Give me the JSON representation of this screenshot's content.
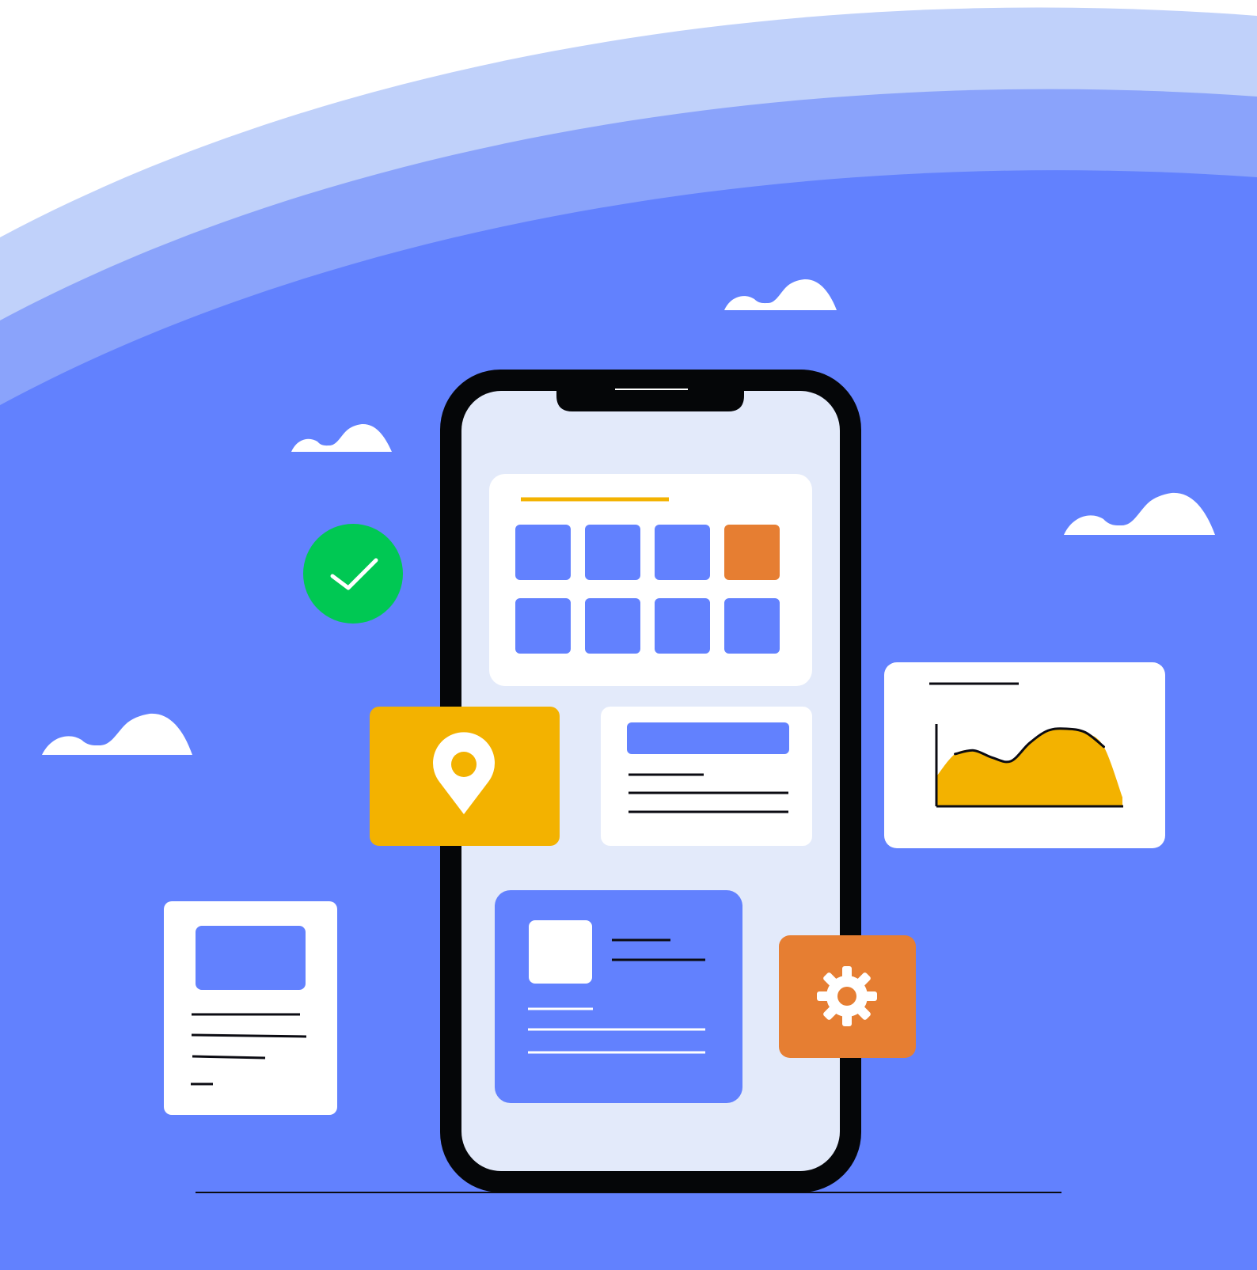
{
  "colors": {
    "sky_top": "#ffffff",
    "band_light": "#c0d1fa",
    "band_mid": "#8aa3fb",
    "background": "#6281fe",
    "phone_frame": "#050608",
    "phone_screen": "#e3eafa",
    "card_white": "#ffffff",
    "tile_blue": "#6281fe",
    "accent_orange": "#e67e32",
    "accent_yellow": "#f3b200",
    "success_green": "#00c853",
    "line_dark": "#0b0b12",
    "cloud": "#ffffff"
  },
  "illustration": {
    "type": "flat mobile app illustration",
    "elements": [
      "cloud",
      "cloud",
      "cloud",
      "cloud",
      "check-icon",
      "map-pin-icon",
      "gear-icon",
      "area-chart",
      "document-card",
      "phone"
    ]
  },
  "app_grid": {
    "rows": 2,
    "cols": 4,
    "highlighted_tile": 3
  },
  "chart_data": {
    "type": "area",
    "title": "",
    "xlabel": "",
    "ylabel": "",
    "x": [
      0,
      1,
      2,
      3,
      4,
      5,
      6,
      7,
      8,
      9,
      10
    ],
    "series": [
      {
        "values": [
          33,
          58,
          62,
          54,
          50,
          70,
          84,
          86,
          82,
          66,
          10
        ]
      }
    ],
    "legend": "none",
    "grid": false
  }
}
